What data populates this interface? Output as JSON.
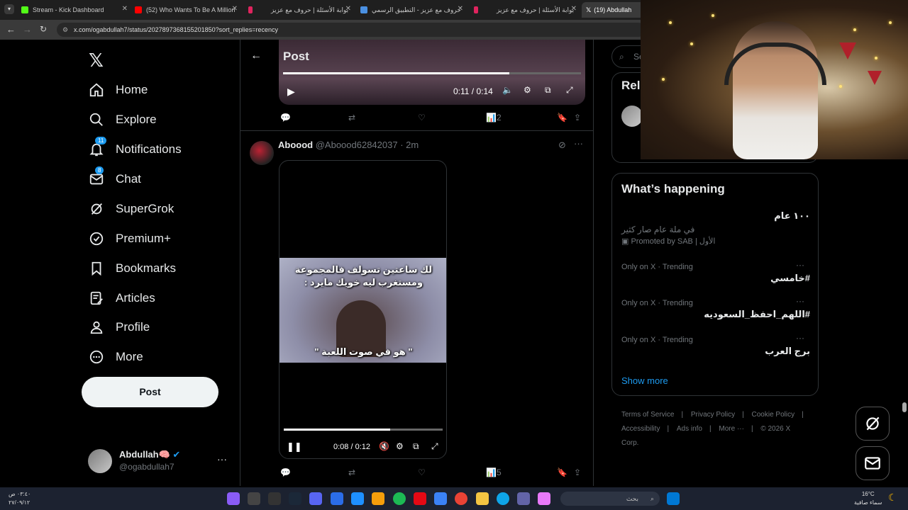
{
  "browser": {
    "tabs": [
      {
        "label": "Stream - Kick Dashboard",
        "color": "#53fc18"
      },
      {
        "label": "(52) Who Wants To Be A Million",
        "color": "#ff0000"
      },
      {
        "label": "بوابة الأسئلة | حروف مع عزيز",
        "color": "#e0245e"
      },
      {
        "label": "حروف مع عزيز - التطبيق الرسمي",
        "color": "#4a90e2"
      },
      {
        "label": "بوابة الأسئلة | حروف مع عزيز",
        "color": "#e0245e"
      },
      {
        "label": "(19) Abdullah",
        "color": "#ffffff"
      }
    ],
    "url": "x.com/ogabdullah7/status/2027897368155201850?sort_replies=recency"
  },
  "nav": {
    "items": [
      {
        "label": "Home",
        "icon": "home-icon"
      },
      {
        "label": "Explore",
        "icon": "search-icon"
      },
      {
        "label": "Notifications",
        "icon": "bell-icon",
        "badge": "11"
      },
      {
        "label": "Chat",
        "icon": "mail-icon",
        "badge": "8"
      },
      {
        "label": "SuperGrok",
        "icon": "grok-icon"
      },
      {
        "label": "Premium+",
        "icon": "verified-icon"
      },
      {
        "label": "Bookmarks",
        "icon": "bookmark-icon"
      },
      {
        "label": "Articles",
        "icon": "articles-icon"
      },
      {
        "label": "Profile",
        "icon": "person-icon"
      },
      {
        "label": "More",
        "icon": "more-circle-icon"
      }
    ],
    "post_label": "Post",
    "account": {
      "name": "Abdullah🧠",
      "handle": "@ogabdullah7"
    }
  },
  "main": {
    "header_title": "Post",
    "video1": {
      "time": "0:11 / 0:14",
      "progress": 0.76
    },
    "post1_views": "2",
    "reply": {
      "name": "Aboood",
      "handle": "@Aboood62842037",
      "time": "· 2m",
      "caption_top": "لك ساعتين تسولف فالمجموعة ومستغرب ليه خويك مايرد :",
      "caption_bottom": "\" هو في صوت اللعبة \"",
      "video_time": "0:08 / 0:12",
      "video_progress": 0.67,
      "views": "5"
    }
  },
  "right": {
    "search_placeholder": "Se",
    "relevant_title": "Rel",
    "happening_title": "What’s happening",
    "promo": {
      "title": "١٠٠ عام",
      "desc": "في ملة عام صار كثير",
      "meta": "Promoted by SAB | الأول"
    },
    "trends": [
      {
        "meta": "Only on X · Trending",
        "name": "#خامسي"
      },
      {
        "meta": "Only on X · Trending",
        "name": "#اللهم_احفظ_السعوديه"
      },
      {
        "meta": "Only on X · Trending",
        "name": "برج العرب"
      }
    ],
    "show_more": "Show more",
    "footer": [
      "Terms of Service",
      "Privacy Policy",
      "Cookie Policy",
      "Accessibility",
      "Ads info",
      "More ···",
      "© 2026 X Corp."
    ]
  },
  "taskbar": {
    "search_text": "بحث",
    "time_left": "٠٣:٤٠ ص",
    "date_left": "٢٧/٠٩/١٢",
    "temp": "16°C",
    "weather": "سماء صافية"
  },
  "colors": {
    "accent": "#1d9bf0",
    "border": "#2f3336",
    "muted": "#71767b"
  }
}
